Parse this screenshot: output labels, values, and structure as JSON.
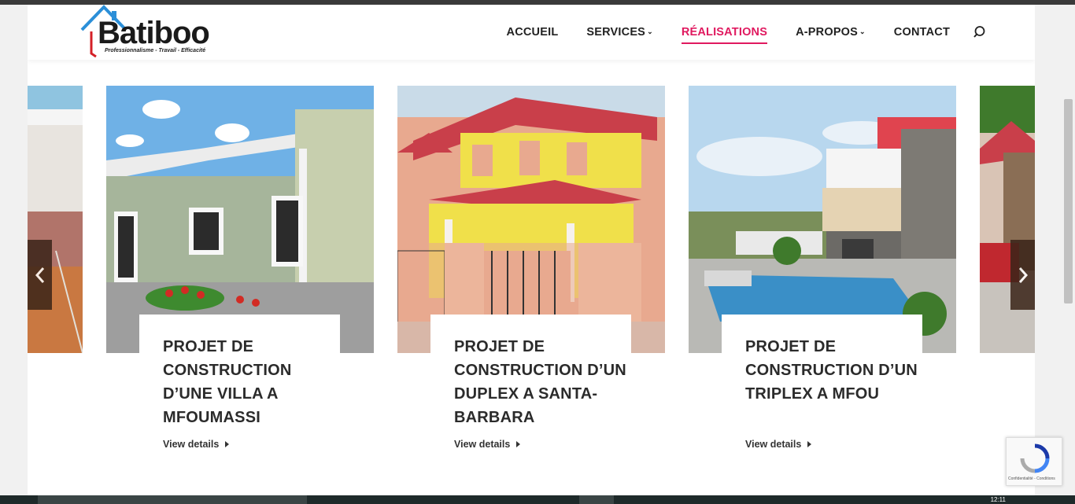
{
  "brand": {
    "name": "Batiboo",
    "tagline": "Professionnalisme - Travail - Efficacité",
    "accent": "#e0195f"
  },
  "nav": {
    "items": [
      {
        "label": "ACCUEIL",
        "dropdown": false,
        "active": false
      },
      {
        "label": "SERVICES",
        "dropdown": true,
        "active": false
      },
      {
        "label": "RÉALISATIONS",
        "dropdown": false,
        "active": true
      },
      {
        "label": "A-PROPOS",
        "dropdown": true,
        "active": false
      },
      {
        "label": "CONTACT",
        "dropdown": false,
        "active": false
      }
    ],
    "search_icon": "search-icon"
  },
  "gallery": {
    "cards": [
      {
        "title": "PROJET DE CONSTRUCTION D’UNE VILLA A MFOUMASSI",
        "link": "View details"
      },
      {
        "title": "PROJET DE CONSTRUCTION D’UN DUPLEX A SANTA-BARBARA",
        "link": "View details"
      },
      {
        "title": "PROJET DE CONSTRUCTION D’UN TRIPLEX A MFOU",
        "link": "View details"
      }
    ],
    "prev_icon": "chevron-left-icon",
    "next_icon": "chevron-right-icon"
  },
  "recaptcha": {
    "text": "Confidentialité - Conditions"
  },
  "taskbar": {
    "clock": "12:11"
  }
}
